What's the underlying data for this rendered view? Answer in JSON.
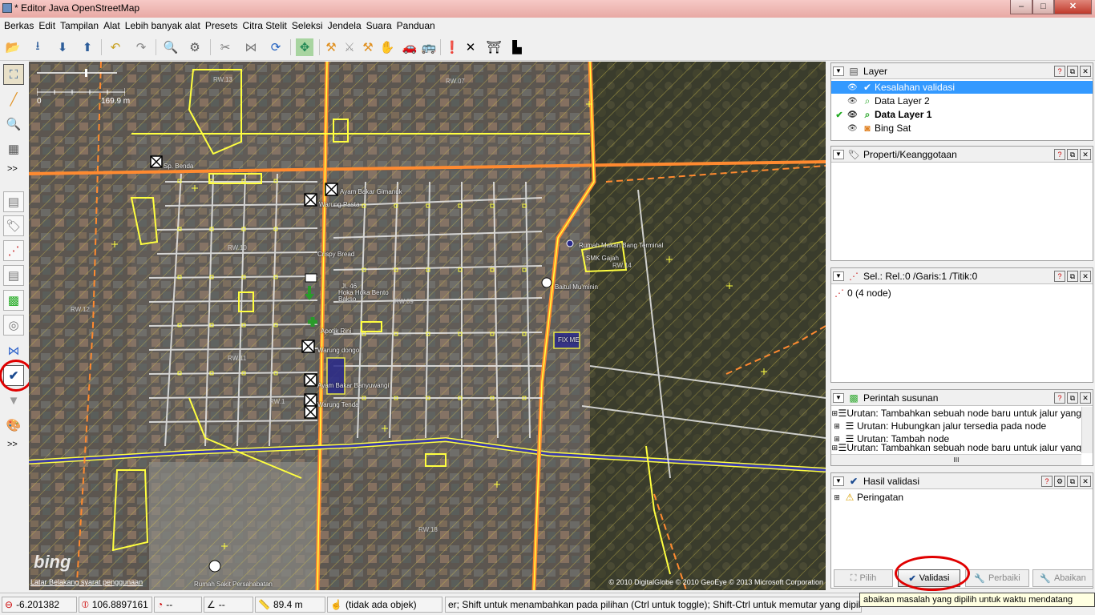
{
  "window": {
    "title": "* Editor Java OpenStreetMap",
    "min": "–",
    "max": "□",
    "close": "✕"
  },
  "menu": [
    "Berkas",
    "Edit",
    "Tampilan",
    "Alat",
    "Lebih banyak alat",
    "Presets",
    "Citra Stelit",
    "Seleksi",
    "Jendela",
    "Suara",
    "Panduan"
  ],
  "map": {
    "scale_start": "0",
    "scale_end": "169.9 m",
    "labels": [
      "Ayam Bakar Gimanuk",
      "Warung Pasta",
      "Crispy Bread",
      "Jl. 46",
      "Hoka Hoka Bento",
      "Bakso",
      "Apotik Rini",
      "Warung dongo",
      "Ayam Bakar Banyuwangi",
      "Warung Tenda",
      "Rumah Makan Bang Terminal",
      "SMK Gajah",
      "Baitul Mu'minin",
      "FIX ME",
      "Rumah Sakit Persahabatan",
      "Sp. Benda"
    ],
    "rw_labels": [
      "RW.13",
      "RW.07",
      "RW.10",
      "RW.12",
      "RW.11",
      "RW.09",
      "RW.18",
      "RW.14",
      "RW.1"
    ],
    "bing": "bing",
    "terms": "Latar Belakang syarat penggunaan",
    "copyright": "© 2010 DigitalGlobe © 2010 GeoEye © 2013 Microsoft Corporation"
  },
  "layers_panel": {
    "title": "Layer",
    "items": [
      {
        "name": "Kesalahan validasi",
        "selected": true
      },
      {
        "name": "Data Layer 2",
        "selected": false
      },
      {
        "name": "Data Layer 1",
        "selected": false,
        "active": true
      },
      {
        "name": "Bing Sat",
        "selected": false
      }
    ]
  },
  "properties_panel": {
    "title": "Properti/Keanggotaan"
  },
  "selection_panel": {
    "title": "Sel.: Rel.:0 /Garis:1 /Titik:0",
    "item": "0 (4 node)"
  },
  "commands_panel": {
    "title": "Perintah susunan",
    "items": [
      "Urutan: Tambahkan sebuah node baru untuk jalur yang",
      "Urutan: Hubungkan jalur tersedia pada node",
      "Urutan: Tambah node",
      "Urutan: Tambahkan sebuah node baru untuk jalur yang"
    ],
    "scroll_grip": "III"
  },
  "validation_panel": {
    "title": "Hasil validasi",
    "items": [
      "Peringatan"
    ],
    "buttons": {
      "select": "Pilih",
      "validate": "Validasi",
      "fix": "Perbaiki",
      "ignore": "Abaikan"
    }
  },
  "status": {
    "lat": "-6.201382",
    "lon": "106.8897161",
    "heading": "--",
    "angle": "--",
    "distance": "89.4 m",
    "object": "(tidak ada objek)",
    "help": "er; Shift untuk menambahkan pada pilihan (Ctrl untuk toggle); Shift-Ctrl untuk memutar yang dipilih; Alt-Ctrl"
  },
  "tooltip": "abaikan masalah yang dipilih untuk waktu mendatang",
  "colors": {
    "road": "#ff8a30",
    "area": "#ffff40",
    "selection": "#3399ff",
    "highlight": "#e00000"
  }
}
